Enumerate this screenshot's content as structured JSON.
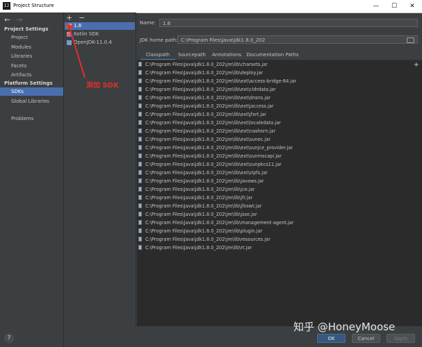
{
  "window": {
    "app_icon_text": "IJ",
    "title": "Project Structure",
    "controls": {
      "minimize": "—",
      "maximize": "☐",
      "close": "✕"
    }
  },
  "nav": {
    "back": "←",
    "forward": "→"
  },
  "sidebar": {
    "project_settings_title": "Project Settings",
    "project_items": [
      "Project",
      "Modules",
      "Libraries",
      "Facets",
      "Artifacts"
    ],
    "platform_settings_title": "Platform Settings",
    "platform_items": [
      "SDKs",
      "Global Libraries"
    ],
    "other_items": [
      "Problems"
    ],
    "selected": "SDKs",
    "help_label": "?"
  },
  "sdk_panel": {
    "add_label": "+",
    "remove_label": "−",
    "items": [
      {
        "name": "1.8",
        "selected": true
      },
      {
        "name": "Kotlin SDK",
        "selected": false
      },
      {
        "name": "OpenJDK-11.0.4",
        "selected": false
      }
    ]
  },
  "annotation": {
    "text": "添加 SDK",
    "color": "#e0302a"
  },
  "detail": {
    "name_label": "Name:",
    "name_value": "1.8",
    "jdk_home_label": "JDK home path:",
    "jdk_home_value": "C:\\Program Files\\Java\\jdk1.8.0_202",
    "tabs": [
      "Classpath",
      "Sourcepath",
      "Annotations",
      "Documentation Paths"
    ],
    "active_tab": "Classpath",
    "side_buttons": [
      "+",
      "−"
    ],
    "classpath": [
      "C:\\Program Files\\Java\\jdk1.8.0_202\\jre\\lib\\charsets.jar",
      "C:\\Program Files\\Java\\jdk1.8.0_202\\jre\\lib\\deploy.jar",
      "C:\\Program Files\\Java\\jdk1.8.0_202\\jre\\lib\\ext\\access-bridge-64.jar",
      "C:\\Program Files\\Java\\jdk1.8.0_202\\jre\\lib\\ext\\cldrdata.jar",
      "C:\\Program Files\\Java\\jdk1.8.0_202\\jre\\lib\\ext\\dnsns.jar",
      "C:\\Program Files\\Java\\jdk1.8.0_202\\jre\\lib\\ext\\jaccess.jar",
      "C:\\Program Files\\Java\\jdk1.8.0_202\\jre\\lib\\ext\\jfxrt.jar",
      "C:\\Program Files\\Java\\jdk1.8.0_202\\jre\\lib\\ext\\localedata.jar",
      "C:\\Program Files\\Java\\jdk1.8.0_202\\jre\\lib\\ext\\nashorn.jar",
      "C:\\Program Files\\Java\\jdk1.8.0_202\\jre\\lib\\ext\\sunec.jar",
      "C:\\Program Files\\Java\\jdk1.8.0_202\\jre\\lib\\ext\\sunjce_provider.jar",
      "C:\\Program Files\\Java\\jdk1.8.0_202\\jre\\lib\\ext\\sunmscapi.jar",
      "C:\\Program Files\\Java\\jdk1.8.0_202\\jre\\lib\\ext\\sunpkcs11.jar",
      "C:\\Program Files\\Java\\jdk1.8.0_202\\jre\\lib\\ext\\zipfs.jar",
      "C:\\Program Files\\Java\\jdk1.8.0_202\\jre\\lib\\javaws.jar",
      "C:\\Program Files\\Java\\jdk1.8.0_202\\jre\\lib\\jce.jar",
      "C:\\Program Files\\Java\\jdk1.8.0_202\\jre\\lib\\jfr.jar",
      "C:\\Program Files\\Java\\jdk1.8.0_202\\jre\\lib\\jfxswt.jar",
      "C:\\Program Files\\Java\\jdk1.8.0_202\\jre\\lib\\jsse.jar",
      "C:\\Program Files\\Java\\jdk1.8.0_202\\jre\\lib\\management-agent.jar",
      "C:\\Program Files\\Java\\jdk1.8.0_202\\jre\\lib\\plugin.jar",
      "C:\\Program Files\\Java\\jdk1.8.0_202\\jre\\lib\\resources.jar",
      "C:\\Program Files\\Java\\jdk1.8.0_202\\jre\\lib\\rt.jar"
    ]
  },
  "buttons": {
    "ok": "OK",
    "cancel": "Cancel",
    "apply": "Apply"
  },
  "watermark": "知乎 @HoneyMoose",
  "colors": {
    "selection": "#4b6eaf",
    "background": "#3c3f41",
    "list_background": "#2b2b2b",
    "ok_button": "#365880"
  }
}
